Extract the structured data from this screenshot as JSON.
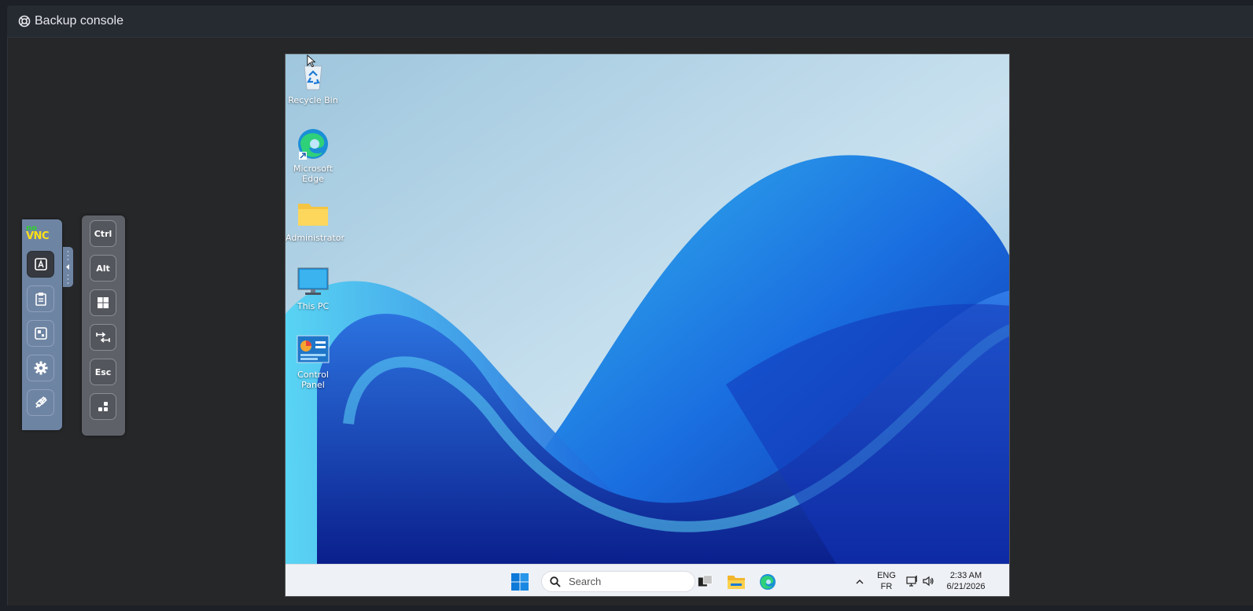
{
  "app": {
    "title": "Backup console"
  },
  "desktop": {
    "icons": [
      {
        "label": "Recycle Bin"
      },
      {
        "label": "Microsoft Edge"
      },
      {
        "label": "Administrator"
      },
      {
        "label": "This PC"
      },
      {
        "label": "Control Panel"
      }
    ]
  },
  "taskbar": {
    "search_placeholder": "Search",
    "lang_top": "ENG",
    "lang_bottom": "FR",
    "time": "2:33 AM",
    "date": "6/21/2026"
  },
  "novnc": {
    "logo_top": "no",
    "logo_bottom": "VNC",
    "keys": {
      "ctrl": "Ctrl",
      "alt": "Alt",
      "esc": "Esc"
    }
  },
  "colors": {
    "panel": "#6e84a3",
    "keys_panel": "#5e6168",
    "accent": "#0078d4"
  }
}
